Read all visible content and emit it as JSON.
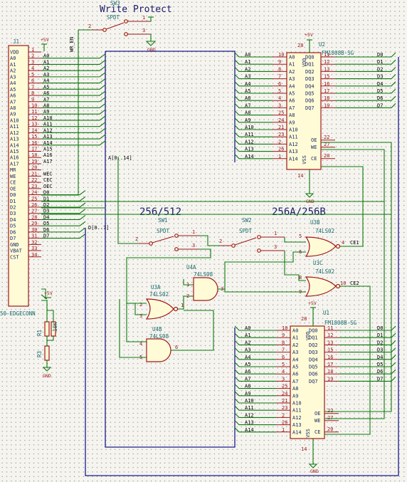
{
  "title": "Write Protect",
  "sw3": {
    "ref": "SW3",
    "value": "SPDT",
    "p1": "1",
    "p2": "2",
    "p3": "3",
    "gnd": "GND"
  },
  "j1": {
    "ref": "J1",
    "value": "50-EDGECONN",
    "pins": [
      "VDD",
      "A0",
      "A1",
      "A2",
      "A3",
      "A4",
      "A5",
      "A6",
      "A7",
      "A8",
      "A9",
      "A10",
      "A11",
      "A12",
      "A13",
      "A14",
      "A15",
      "A16",
      "A17",
      "MR",
      "WE",
      "CE",
      "OE",
      "D0",
      "D1",
      "D2",
      "D3",
      "D4",
      "D5",
      "D6",
      "D7",
      "GND",
      "VBAT",
      "CST"
    ],
    "nums": [
      "1",
      "2",
      "3",
      "4",
      "5",
      "6",
      "7",
      "8",
      "9",
      "10",
      "11",
      "12",
      "13",
      "14",
      "15",
      "16",
      "17",
      "18",
      "19",
      "20",
      "21",
      "22",
      "23",
      "24",
      "25",
      "26",
      "27",
      "28",
      "29",
      "30",
      "31",
      "32",
      "33",
      "34"
    ],
    "vcc": "+5V"
  },
  "wr_en": "WR_EN",
  "bus_a": "A[0..14]",
  "bus_d": "D[0..7]",
  "edge_nets": [
    "A0",
    "A1",
    "A2",
    "A3",
    "A4",
    "A5",
    "A6",
    "A7",
    "A8",
    "A9",
    "A10",
    "A11",
    "A12",
    "A13",
    "A14",
    "A15",
    "A16",
    "A17"
  ],
  "edge_ctrl": [
    "WEC",
    "CEC",
    "OEC",
    "D0",
    "D1",
    "D2",
    "D3",
    "D4",
    "D5",
    "D6",
    "D7"
  ],
  "label_256_512": "256/512",
  "label_256a_256b": "256A/256B",
  "sw1": {
    "ref": "SW1",
    "value": "SPDT",
    "p1": "1",
    "p2": "2",
    "p3": "3"
  },
  "sw2": {
    "ref": "SW2",
    "value": "SPDT",
    "p1": "1",
    "p2": "2",
    "p3": "3"
  },
  "u2": {
    "ref": "U2",
    "value": "FM1808B-SG",
    "vcc": "+5V",
    "gnd": "GND",
    "left": [
      "A0",
      "A1",
      "A2",
      "A3",
      "A4",
      "A5",
      "A6",
      "A7",
      "A8",
      "A9",
      "A10",
      "A11",
      "A12",
      "A13",
      "A14"
    ],
    "leftnums": [
      "10",
      "9",
      "8",
      "7",
      "6",
      "5",
      "4",
      "3",
      "25",
      "24",
      "21",
      "23",
      "2",
      "26",
      "1"
    ],
    "right": [
      "DQ0",
      "DQ1",
      "DQ2",
      "DQ3",
      "DQ4",
      "DQ5",
      "DQ6",
      "DQ7"
    ],
    "rightnums": [
      "11",
      "12",
      "13",
      "15",
      "16",
      "17",
      "18",
      "19"
    ],
    "vdd": "VDD",
    "vss": "VSS",
    "oe": "OE",
    "we": "WE",
    "ce": "CE",
    "oenum": "22",
    "wenum": "27",
    "cenum": "20",
    "vddnum": "28",
    "vssnum": "14"
  },
  "u1": {
    "ref": "U1",
    "value": "FM1808B-SG",
    "vcc": "+5V",
    "gnd": "GND",
    "left": [
      "A0",
      "A1",
      "A2",
      "A3",
      "A4",
      "A5",
      "A6",
      "A7",
      "A8",
      "A9",
      "A10",
      "A11",
      "A12",
      "A13",
      "A14"
    ],
    "leftnums": [
      "10",
      "9",
      "8",
      "7",
      "6",
      "5",
      "4",
      "3",
      "25",
      "24",
      "21",
      "23",
      "2",
      "26",
      "1"
    ],
    "right": [
      "DQ0",
      "DQ1",
      "DQ2",
      "DQ3",
      "DQ4",
      "DQ5",
      "DQ6",
      "DQ7"
    ],
    "rightnums": [
      "11",
      "12",
      "13",
      "15",
      "16",
      "17",
      "18",
      "19"
    ],
    "vdd": "VDD",
    "vss": "VSS",
    "oe": "OE",
    "we": "WE",
    "ce": "CE",
    "oenum": "22",
    "wenum": "27",
    "cenum": "20",
    "vddnum": "28",
    "vssnum": "14"
  },
  "u2_nets_left": [
    "A0",
    "A1",
    "A2",
    "A3",
    "A4",
    "A5",
    "A6",
    "A7",
    "A8",
    "A9",
    "A10",
    "A11",
    "A12",
    "A13",
    "A14"
  ],
  "u2_nets_right": [
    "D0",
    "D1",
    "D2",
    "D3",
    "D4",
    "D5",
    "D6",
    "D7"
  ],
  "u1_nets_left": [
    "A0",
    "A1",
    "A2",
    "A3",
    "A4",
    "A5",
    "A6",
    "A7",
    "A8",
    "A9",
    "A10",
    "A11",
    "A12",
    "A13",
    "A14"
  ],
  "u1_nets_right": [
    "D0",
    "D1",
    "D2",
    "D3",
    "D4",
    "D5",
    "D6",
    "D7"
  ],
  "u3b": {
    "ref": "U3B",
    "value": "74LS02",
    "p1": "5",
    "p2": "6",
    "p3": "4",
    "out": "CE1"
  },
  "u3c": {
    "ref": "U3C",
    "value": "74LS02",
    "p1": "8",
    "p2": "9",
    "p3": "10",
    "out": "CE2"
  },
  "u3a": {
    "ref": "U3A",
    "value": "74LS02",
    "p1": "2",
    "p2": "3",
    "p3": "1"
  },
  "u4a": {
    "ref": "U4A",
    "value": "74LS08",
    "p1": "1",
    "p2": "2",
    "p3": "3"
  },
  "u4b": {
    "ref": "U4B",
    "value": "74LS08",
    "p1": "4",
    "p2": "5",
    "p3": "6"
  },
  "r1": {
    "ref": "R1",
    "value": "10K"
  },
  "r2": {
    "ref": "R2",
    "value": "10K"
  },
  "r3": {
    "ref": "R3",
    "value": "10K"
  },
  "bot": {
    "vcc": "+5V",
    "gnd": "GND"
  }
}
